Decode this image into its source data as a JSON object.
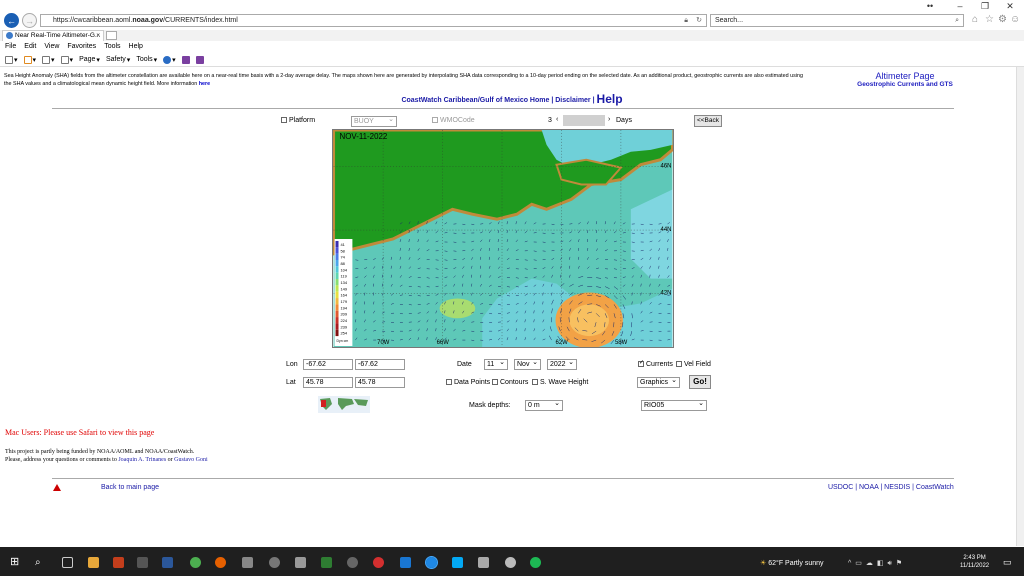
{
  "browser": {
    "url_prefix": "https://cwcaribbean.aoml.",
    "url_domain": "noaa.gov",
    "url_suffix": "/CURRENTS/index.html",
    "search_placeholder": "Search...",
    "tab_title": "Near Real-Time Altimeter-G...",
    "menu": [
      "File",
      "Edit",
      "View",
      "Favorites",
      "Tools",
      "Help"
    ],
    "commands": {
      "page": "Page",
      "safety": "Safety",
      "tools": "Tools"
    },
    "icons": [
      "back-arrow-icon",
      "forward-arrow-icon",
      "lock-icon",
      "refresh-icon",
      "search-icon",
      "home-icon",
      "star-icon",
      "gear-icon",
      "smiley-icon"
    ]
  },
  "page": {
    "intro": "Sea Height Anomaly (SHA) fields from the altimeter constellation are available here on a near-real time basis with a 2-day average delay. The maps shown here are generated by interpolating SHA data corresponding to a 10-day period ending on the selected date. As an additional product, geostrophic currents are also estimated using the SHA values and a climatological mean dynamic height field. More information",
    "intro_link": "here",
    "altimeter_title": "Altimeter Page",
    "altimeter_sub": "Geostrophic Currents and GTS",
    "top_links": {
      "coastwatch": "CoastWatch Caribbean/Gulf of Mexico Home",
      "sep": " | ",
      "disclaimer": "Disclaimer",
      "help": "Help"
    },
    "platform_label": "Platform",
    "platform_value": "BUOY",
    "wmo_label": "WMOCode",
    "days_count": "3",
    "days_label": "Days",
    "back_button": "<<Back",
    "map": {
      "date_label": "NOV-11-2022",
      "lat_labels": [
        "46N",
        "44N",
        "42N"
      ],
      "lon_labels": [
        "70W",
        "66W",
        "62W",
        "58W"
      ],
      "legend_values": [
        "41",
        "58",
        "74",
        "88",
        "104",
        "119",
        "134",
        "149",
        "164",
        "179",
        "194",
        "209",
        "224",
        "239",
        "254"
      ],
      "legend_unit": "Dyn\ncm",
      "colors": {
        "land": "#1f9a1f",
        "ocean": "#5ec8b8",
        "eddy": "#f2a246",
        "coast": "#c08a3a",
        "legend_top": "#3040c0"
      }
    },
    "lon_label": "Lon",
    "lon_min": "-67.62",
    "lon_max": "-67.62",
    "lat_label": "Lat",
    "lat_min": "45.78",
    "lat_max": "45.78",
    "date_label": "Date",
    "day": "11",
    "month": "Nov",
    "year": "2022",
    "currents_label": "Currents",
    "velfield_label": "Vel Field",
    "datapoints_label": "Data Points",
    "contours_label": "Contours",
    "swave_label": "S. Wave Height",
    "graphics_value": "Graphics",
    "go_button": "Go!",
    "mask_label": "Mask depths:",
    "mask_value": "0 m",
    "product_value": "RIO05",
    "mac_note": "Mac Users: Please use Safari to view this page",
    "funding_line1": "This project is partly being funded by NOAA/AOML and NOAA/CoastWatch.",
    "funding_line2_prefix": "Please, address your questions or comments to",
    "contact1": "Joaquin A. Trinanes",
    "contact_or": "or",
    "contact2": "Gustavo Goni",
    "back_main": "Back to main page",
    "bottom_links": "USDOC | NOAA | NESDIS | CoastWatch"
  },
  "taskbar": {
    "weather": "62°F  Partly sunny",
    "time": "2:43 PM",
    "date": "11/11/2022"
  }
}
